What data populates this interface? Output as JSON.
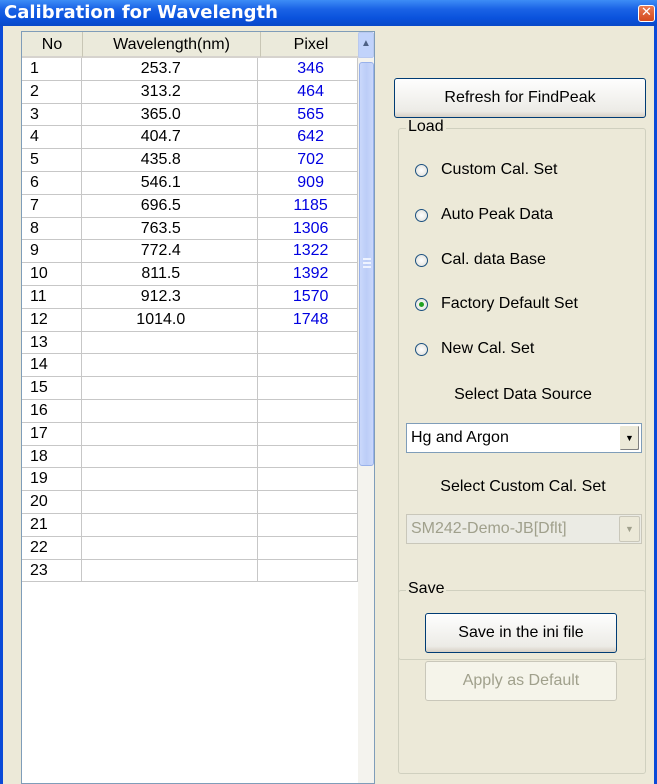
{
  "window": {
    "title": "Calibration for Wavelength",
    "close_glyph": "✕"
  },
  "table": {
    "headers": {
      "no": "No",
      "wavelength": "Wavelength(nm)",
      "pixel": "Pixel"
    },
    "rows": [
      {
        "no": "1",
        "wavelength": "253.7",
        "pixel": "346"
      },
      {
        "no": "2",
        "wavelength": "313.2",
        "pixel": "464"
      },
      {
        "no": "3",
        "wavelength": "365.0",
        "pixel": "565"
      },
      {
        "no": "4",
        "wavelength": "404.7",
        "pixel": "642"
      },
      {
        "no": "5",
        "wavelength": "435.8",
        "pixel": "702"
      },
      {
        "no": "6",
        "wavelength": "546.1",
        "pixel": "909"
      },
      {
        "no": "7",
        "wavelength": "696.5",
        "pixel": "1185"
      },
      {
        "no": "8",
        "wavelength": "763.5",
        "pixel": "1306"
      },
      {
        "no": "9",
        "wavelength": "772.4",
        "pixel": "1322"
      },
      {
        "no": "10",
        "wavelength": "811.5",
        "pixel": "1392"
      },
      {
        "no": "11",
        "wavelength": "912.3",
        "pixel": "1570"
      },
      {
        "no": "12",
        "wavelength": "1014.0",
        "pixel": "1748"
      },
      {
        "no": "13",
        "wavelength": "",
        "pixel": ""
      },
      {
        "no": "14",
        "wavelength": "",
        "pixel": ""
      },
      {
        "no": "15",
        "wavelength": "",
        "pixel": ""
      },
      {
        "no": "16",
        "wavelength": "",
        "pixel": ""
      },
      {
        "no": "17",
        "wavelength": "",
        "pixel": ""
      },
      {
        "no": "18",
        "wavelength": "",
        "pixel": ""
      },
      {
        "no": "19",
        "wavelength": "",
        "pixel": ""
      },
      {
        "no": "20",
        "wavelength": "",
        "pixel": ""
      },
      {
        "no": "21",
        "wavelength": "",
        "pixel": ""
      },
      {
        "no": "22",
        "wavelength": "",
        "pixel": ""
      },
      {
        "no": "23",
        "wavelength": "",
        "pixel": ""
      }
    ]
  },
  "refresh_button": "Refresh for FindPeak",
  "load": {
    "title": "Load",
    "options": [
      {
        "label": "Custom Cal. Set",
        "checked": false
      },
      {
        "label": "Auto Peak Data",
        "checked": false
      },
      {
        "label": "Cal. data Base",
        "checked": false
      },
      {
        "label": "Factory Default Set",
        "checked": true
      },
      {
        "label": "New Cal. Set",
        "checked": false
      }
    ],
    "data_source_label": "Select Data Source",
    "data_source_value": "Hg and Argon",
    "custom_set_label": "Select Custom Cal. Set",
    "custom_set_value": "SM242-Demo-JB[Dflt]"
  },
  "save": {
    "title": "Save",
    "save_ini_button": "Save in the ini file",
    "apply_default_button": "Apply as Default"
  },
  "colors": {
    "title_bar": "#0a52dc",
    "pixel_text": "#0000e0",
    "face": "#ece9d8",
    "selected_radio": "#21a121"
  }
}
